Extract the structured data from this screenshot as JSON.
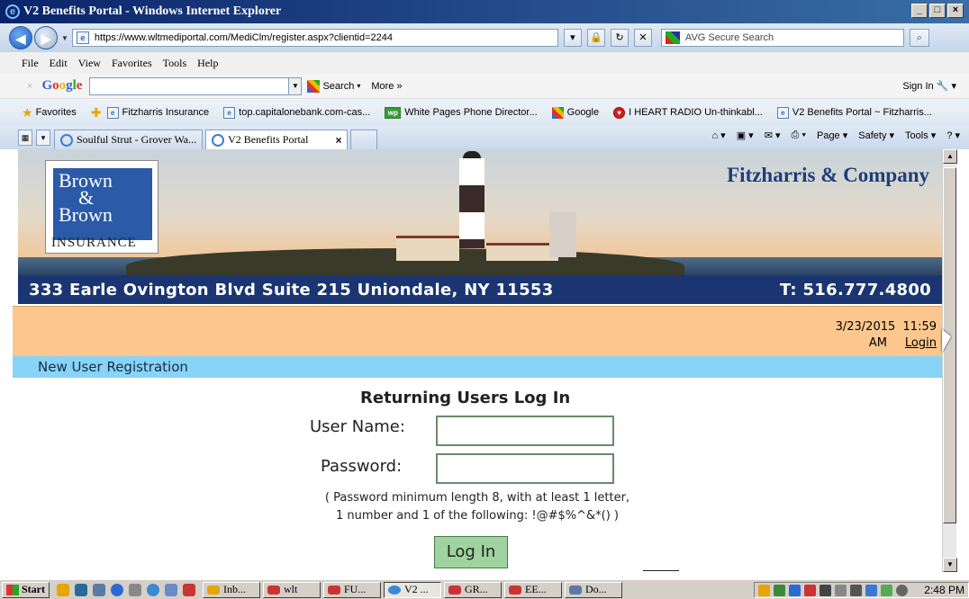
{
  "window": {
    "title": "V2 Benefits Portal - Windows Internet Explorer"
  },
  "address_bar": {
    "url": "https://www.wltmediportal.com/MediClm/register.aspx?clientid=2244",
    "search_placeholder": "AVG Secure Search"
  },
  "menu": [
    "File",
    "Edit",
    "View",
    "Favorites",
    "Tools",
    "Help"
  ],
  "google_toolbar": {
    "search_label": "Search",
    "more_label": "More »",
    "signin_label": "Sign In"
  },
  "favorites_bar": {
    "label": "Favorites",
    "items": [
      "Fitzharris Insurance",
      "top.capitalonebank.com-cas...",
      "White Pages Phone Director...",
      "Google",
      "I HEART RADIO Un-thinkabl...",
      "V2 Benefits Portal ~ Fitzharris..."
    ]
  },
  "tabs": [
    {
      "label": "Soulful Strut - Grover Wa..."
    },
    {
      "label": "V2 Benefits Portal"
    }
  ],
  "command_bar": [
    "Page ▾",
    "Safety ▾",
    "Tools ▾"
  ],
  "banner": {
    "logo_line1": "Brown",
    "logo_line2": "&",
    "logo_line3": "Brown",
    "logo_insurance": "INSURANCE",
    "company": "Fitzharris & Company",
    "address": "333 Earle Ovington Blvd Suite 215 Uniondale, NY 11553",
    "phone": "T: 516.777.4800"
  },
  "status": {
    "date": "3/23/2015",
    "time": "11:59",
    "ampm": "AM",
    "login_link": "Login"
  },
  "section_title": "New User Registration",
  "form": {
    "heading": "Returning Users Log In",
    "username_label": "User Name:",
    "password_label": "Password:",
    "hint_line1": "( Password minimum length 8, with at least 1 letter,",
    "hint_line2": "1 number and 1 of the following: !@#$%^&*() )",
    "login_button": "Log In"
  },
  "taskbar": {
    "start": "Start",
    "buttons": [
      "Inb...",
      "wlt",
      "FU...",
      "V2 ...",
      "GR...",
      "EE...",
      "Do..."
    ],
    "clock": "2:48 PM"
  }
}
